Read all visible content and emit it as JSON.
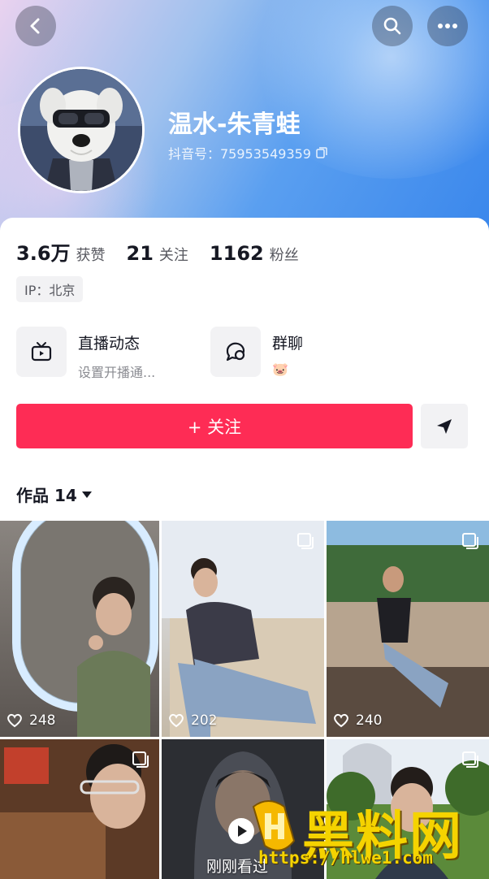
{
  "profile": {
    "nickname": "温水-朱青蛙",
    "douyin_id": "抖音号：75953549359"
  },
  "stats": [
    {
      "value": "3.6万",
      "label": "获赞"
    },
    {
      "value": "21",
      "label": "关注"
    },
    {
      "value": "1162",
      "label": "粉丝"
    }
  ],
  "ip": "IP：北京",
  "features": [
    {
      "title": "直播动态",
      "subtitle": "设置开播通...",
      "icon": "tv-icon"
    },
    {
      "title": "群聊",
      "subtitle": "🐷",
      "icon": "chat-bubble-icon"
    }
  ],
  "actions": {
    "follow_label": "+ 关注",
    "send_icon": "send-arrow-icon"
  },
  "works": {
    "label": "作品 14",
    "items": [
      {
        "likes": "248",
        "multi": false
      },
      {
        "likes": "202",
        "multi": true
      },
      {
        "likes": "240",
        "multi": true
      },
      {
        "likes": "",
        "multi": true
      },
      {
        "likes": "",
        "multi": false
      },
      {
        "likes": "",
        "multi": true
      }
    ],
    "recent_label": "刚刚看过"
  },
  "watermark": {
    "text": "黑料网",
    "url": "https://hlwe1.com"
  },
  "colors": {
    "accent": "#fe2c55",
    "header_gradient_start": "#e9d2ef",
    "header_gradient_end": "#3a87ec"
  }
}
